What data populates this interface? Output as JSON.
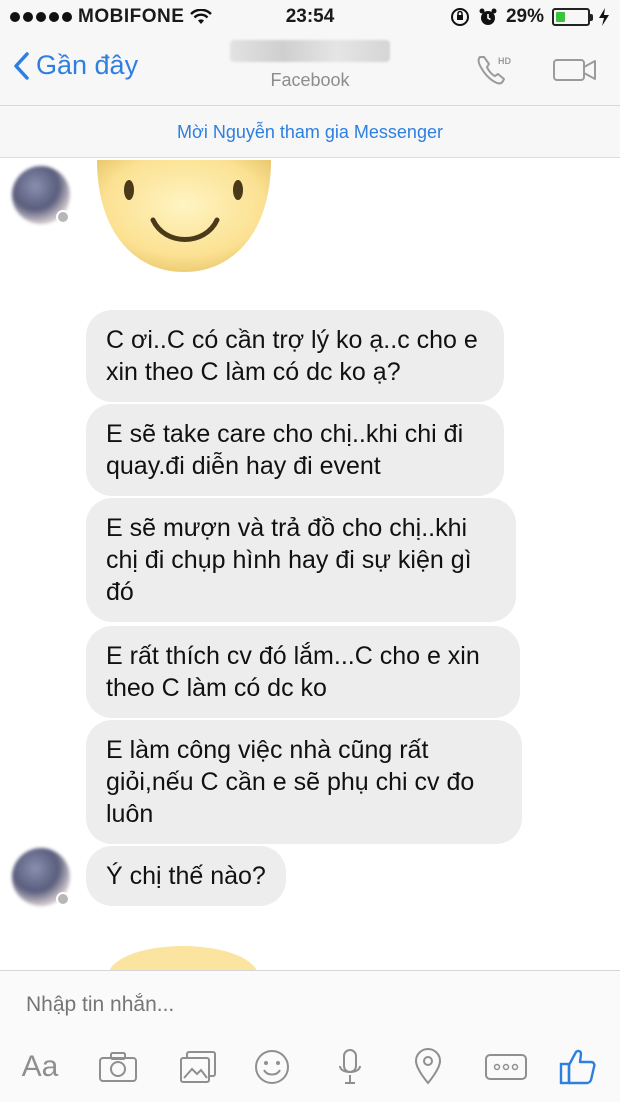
{
  "status_bar": {
    "carrier": "MOBIFONE",
    "time": "23:54",
    "battery": "29%",
    "battery_level": 0.29
  },
  "nav": {
    "back_label": "Gần đây",
    "subtitle": "Facebook"
  },
  "invite_banner": "Mời Nguyễn tham gia Messenger",
  "messages": [
    "C ơi..C có cần trợ lý ko ạ..c cho e xin theo C làm có dc ko ạ?",
    "E sẽ take care cho chị..khi chi đi quay.đi diễn hay đi event",
    "E sẽ mượn và trả đồ cho chị..khi chị đi chụp hình hay đi sự kiện gì đó",
    "E rất thích cv đó lắm...C cho e xin theo C làm có dc ko",
    "E làm công việc nhà cũng rất giỏi,nếu C cần e sẽ phụ chi cv đo luôn",
    "Ý chị thế nào?"
  ],
  "composer": {
    "placeholder": "Nhập tin nhắn...",
    "aa_label": "Aa"
  },
  "colors": {
    "accent": "#2d7fe0",
    "bubble": "#ededed",
    "icon_gray": "#8f8f8f"
  }
}
